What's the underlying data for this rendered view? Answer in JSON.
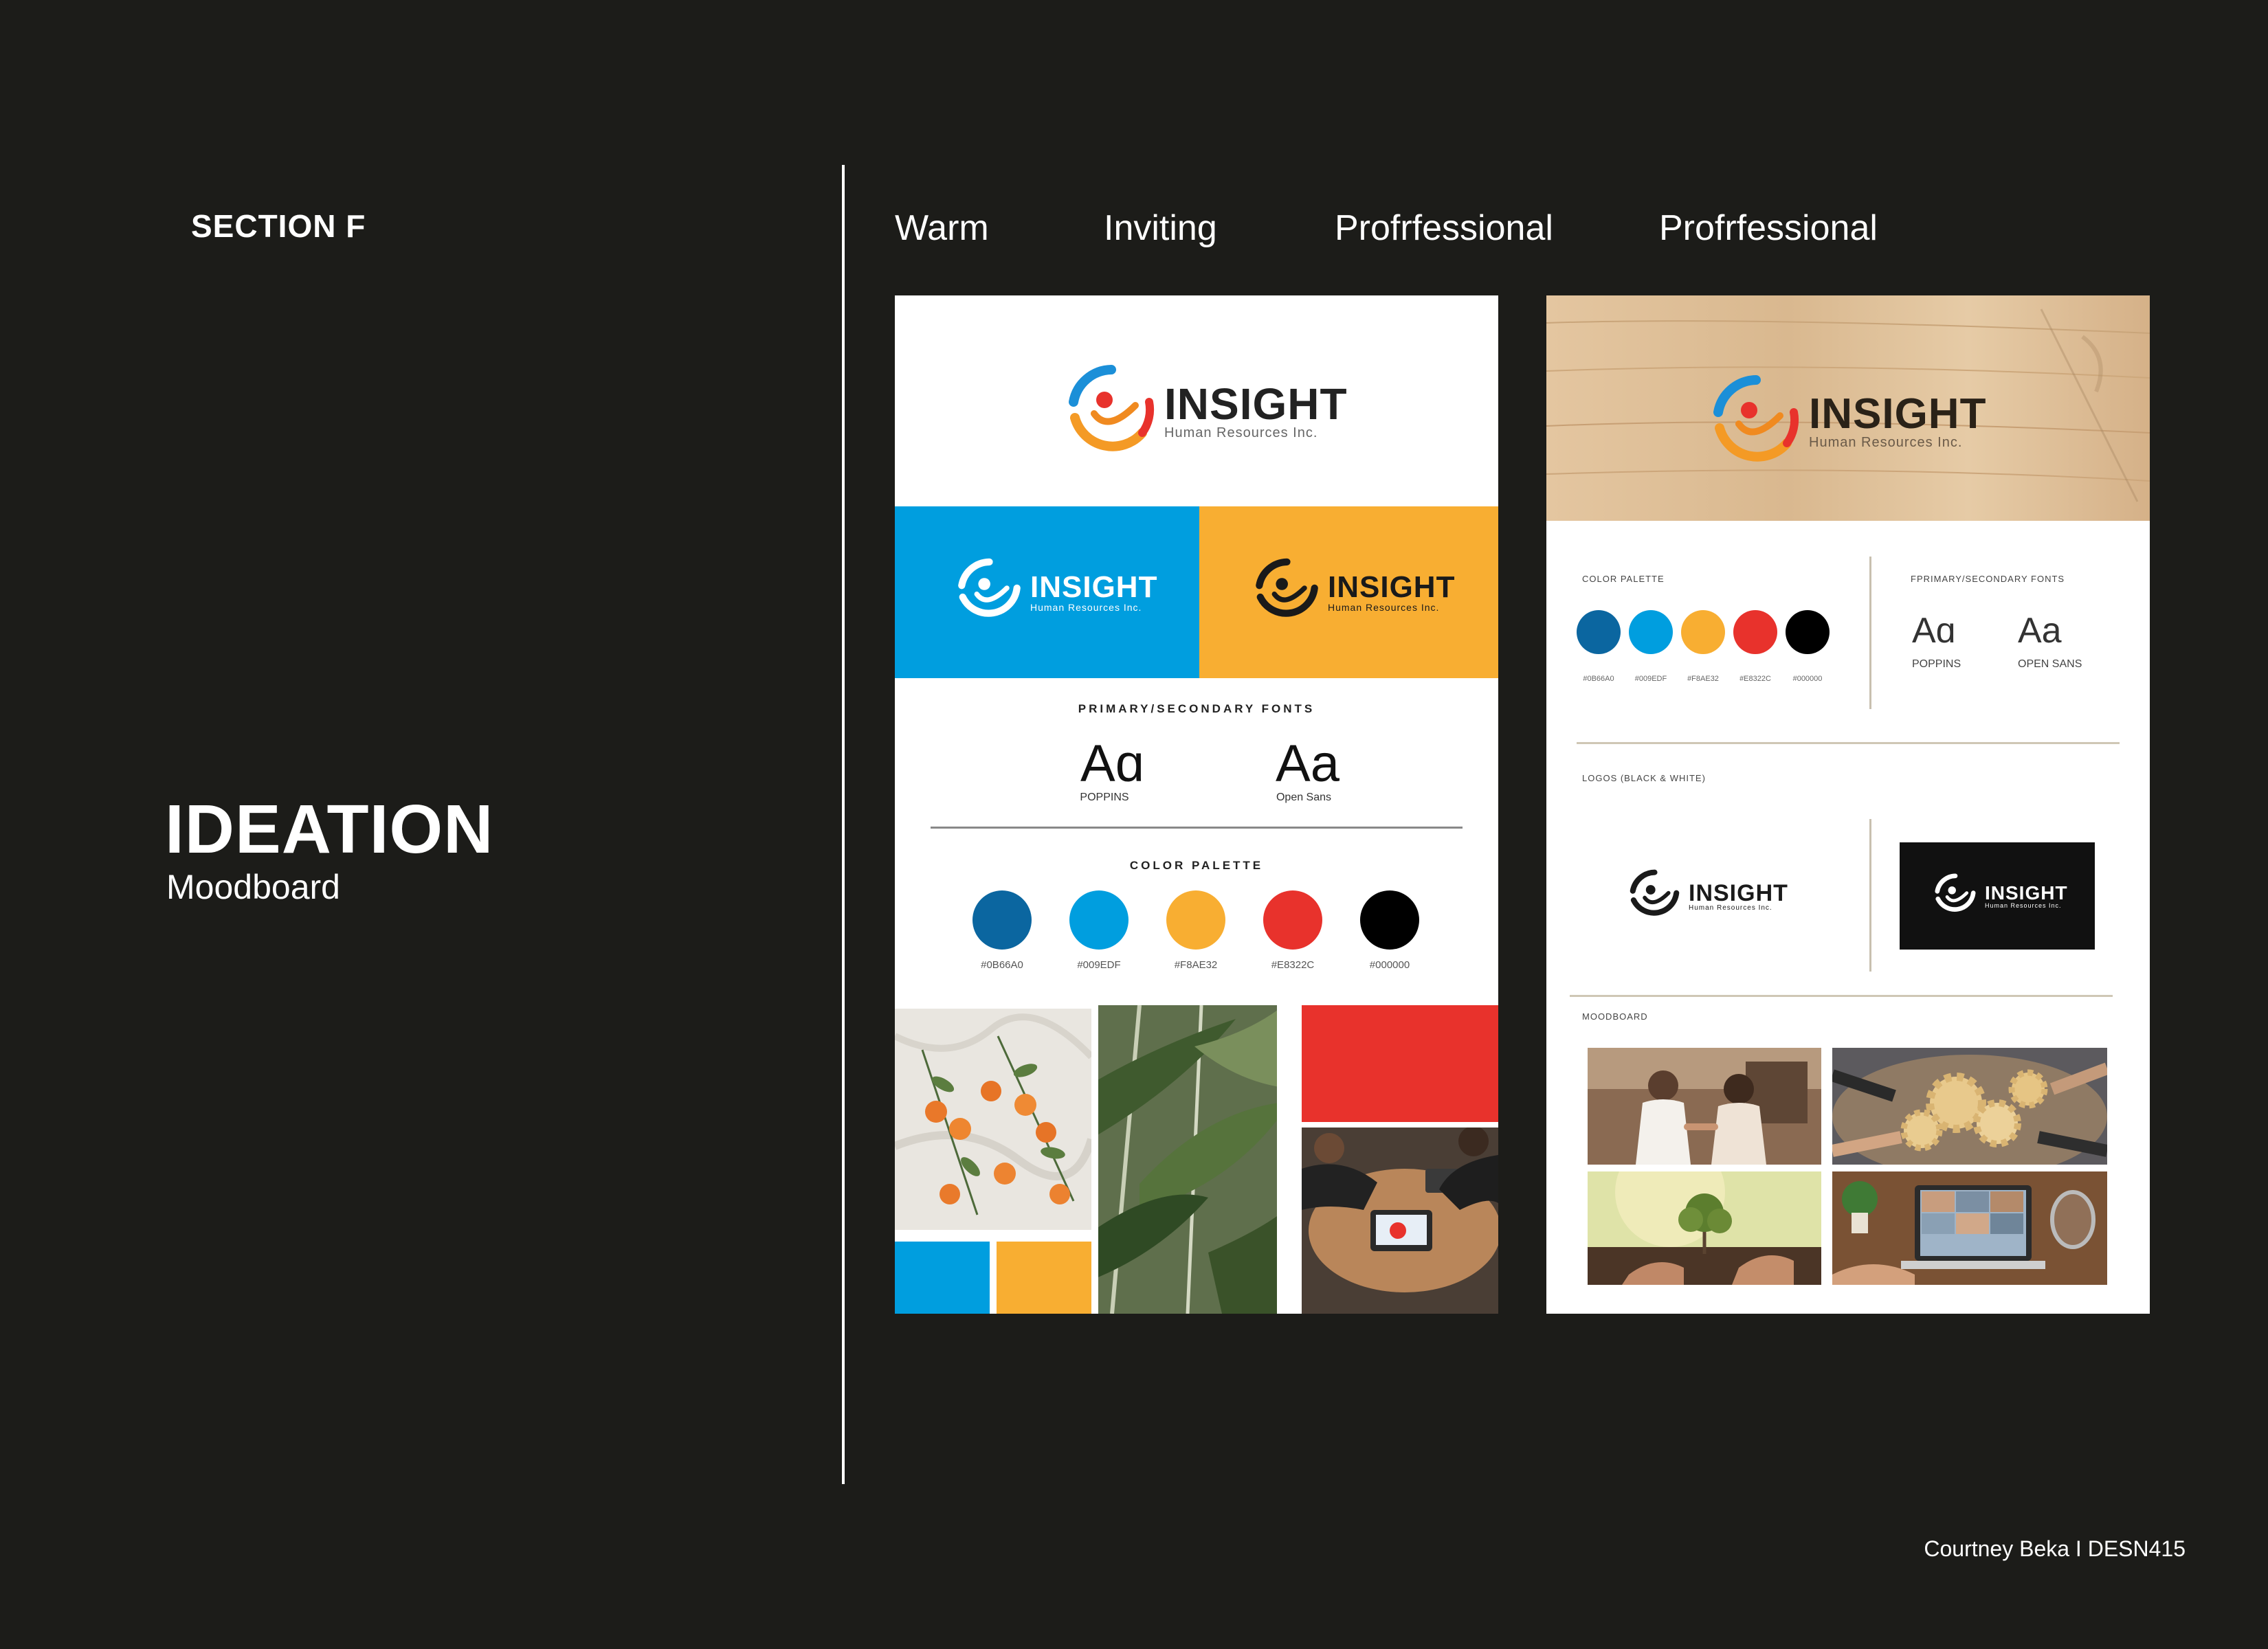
{
  "section": "SECTION F",
  "title": "IDEATION",
  "subtitle": "Moodboard",
  "keywords": [
    "Warm",
    "Inviting",
    "Profrfessional",
    "Profrfessional"
  ],
  "credit": "Courtney Beka I DESN415",
  "colors": {
    "background": "#1c1c19",
    "blue": "#0B66A0",
    "light_blue": "#009EDF",
    "yellow": "#F8AE32",
    "red": "#E8322C",
    "black": "#000000"
  },
  "board1": {
    "logo_title": "INSIGHT",
    "logo_sub": "Human Resources Inc.",
    "fonts_heading": "PRIMARY/SECONDARY FONTS",
    "font_primary_sample": "Aɑ",
    "font_primary_name": "POPPINS",
    "font_secondary_sample": "Aa",
    "font_secondary_name": "Open Sans",
    "palette_heading": "COLOR PALETTE",
    "swatches": [
      {
        "hex": "#0B66A0",
        "label": "#0B66A0"
      },
      {
        "hex": "#009EDF",
        "label": "#009EDF"
      },
      {
        "hex": "#F8AE32",
        "label": "#F8AE32"
      },
      {
        "hex": "#E8322C",
        "label": "#E8322C"
      },
      {
        "hex": "#000000",
        "label": "#000000"
      }
    ],
    "photos": [
      "oranges-photo",
      "palm-leaves-photo",
      "meeting-handshake-photo"
    ]
  },
  "board2": {
    "logo_title": "INSIGHT",
    "logo_sub": "Human Resources Inc.",
    "palette_heading": "COLOR PALETTE",
    "fonts_heading": "FPRIMARY/SECONDARY FONTS",
    "font_primary_sample": "Aɑ",
    "font_primary_name": "POPPINS",
    "font_secondary_sample": "Aa",
    "font_secondary_name": "OPEN SANS",
    "swatches": [
      {
        "hex": "#0B66A0",
        "label": "#0B66A0"
      },
      {
        "hex": "#009EDF",
        "label": "#009EDF"
      },
      {
        "hex": "#F8AE32",
        "label": "#F8AE32"
      },
      {
        "hex": "#E8322C",
        "label": "#E8322C"
      },
      {
        "hex": "#000000",
        "label": "#000000"
      }
    ],
    "logos_heading": "LOGOS (BLACK & WHITE)",
    "moodboard_heading": "MOODBOARD",
    "photos": [
      "office-handshake-photo",
      "gears-teamwork-photo",
      "planting-tree-photo",
      "video-call-desk-photo"
    ]
  }
}
